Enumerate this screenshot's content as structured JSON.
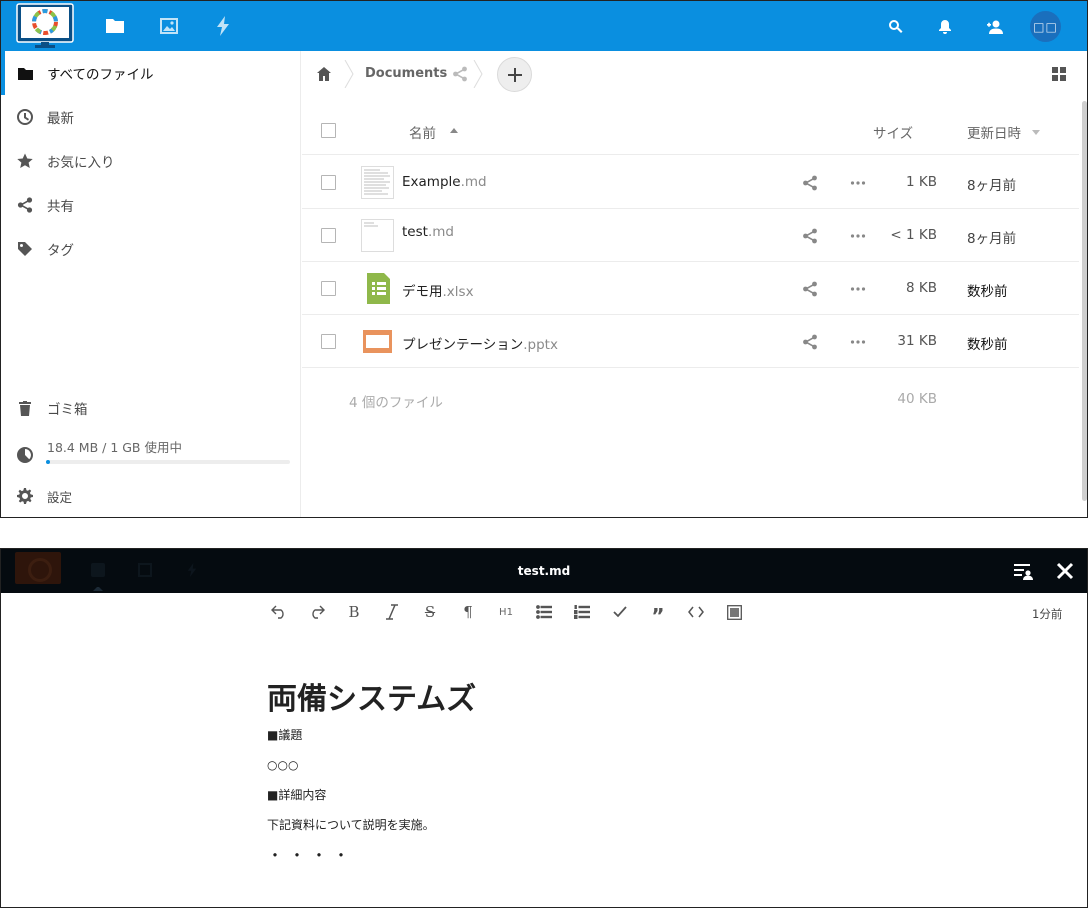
{
  "files_app": {
    "header": {
      "nav": [
        "files-icon",
        "photos-icon",
        "activity-icon"
      ],
      "right_icons": [
        "search-icon",
        "notifications-icon",
        "contacts-icon"
      ],
      "avatar_text": "□□",
      "brand_color": "#0a8fe0"
    },
    "sidebar": {
      "items": [
        {
          "label": "すべてのファイル",
          "icon": "folder-icon",
          "active": true
        },
        {
          "label": "最新",
          "icon": "clock-icon"
        },
        {
          "label": "お気に入り",
          "icon": "star-icon"
        },
        {
          "label": "共有",
          "icon": "share-icon"
        },
        {
          "label": "タグ",
          "icon": "tag-icon"
        }
      ],
      "trash_label": "ゴミ箱",
      "quota_label": "18.4 MB / 1 GB 使用中",
      "quota_fraction": 0.018,
      "settings_label": "設定"
    },
    "breadcrumb": {
      "current": "Documents"
    },
    "table": {
      "col_name": "名前",
      "col_size": "サイズ",
      "col_modified": "更新日時",
      "rows": [
        {
          "base": "Example",
          "ext": ".md",
          "size": "1 KB",
          "modified": "8ヶ月前",
          "type": "markdown-thumbnail"
        },
        {
          "base": "test",
          "ext": ".md",
          "size": "< 1 KB",
          "modified": "8ヶ月前",
          "type": "markdown-thumbnail"
        },
        {
          "base": "デモ用",
          "ext": ".xlsx",
          "size": "8 KB",
          "modified": "数秒前",
          "type": "spreadsheet-icon"
        },
        {
          "base": "プレゼンテーション",
          "ext": ".pptx",
          "size": "31 KB",
          "modified": "数秒前",
          "type": "presentation-icon"
        }
      ],
      "summary_count": "4 個のファイル",
      "summary_size": "40 KB"
    }
  },
  "editor": {
    "title": "test.md",
    "save_status": "1分前",
    "toolbar": [
      "undo-icon",
      "redo-icon",
      "bold-icon",
      "italic-icon",
      "strikethrough-icon",
      "paragraph-icon",
      "heading-icon",
      "bullet-list-icon",
      "numbered-list-icon",
      "checklist-icon",
      "blockquote-icon",
      "code-icon",
      "image-icon"
    ],
    "heading_button_label": "H1",
    "document": {
      "heading": "両備システムズ",
      "lines": [
        "■議題",
        "○○○",
        "■詳細内容",
        "下記資料について説明を実施。"
      ],
      "trailing": "・・・・"
    }
  }
}
